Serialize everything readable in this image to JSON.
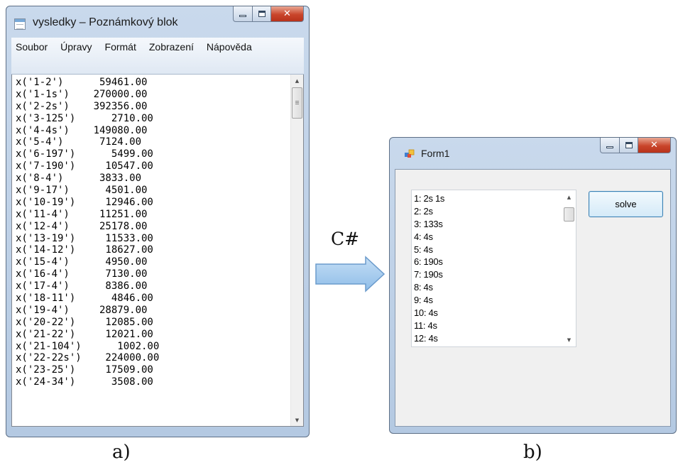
{
  "notepad": {
    "title": "vysledky – Poznámkový blok",
    "menu": [
      "Soubor",
      "Úpravy",
      "Formát",
      "Zobrazení",
      "Nápověda"
    ],
    "lines": [
      "x('1-2')      59461.00",
      "x('1-1s')    270000.00",
      "x('2-2s')    392356.00",
      "x('3-125')      2710.00",
      "x('4-4s')    149080.00",
      "x('5-4')      7124.00",
      "x('6-197')      5499.00",
      "x('7-190')     10547.00",
      "x('8-4')      3833.00",
      "x('9-17')      4501.00",
      "x('10-19')     12946.00",
      "x('11-4')     11251.00",
      "x('12-4')     25178.00",
      "x('13-19')     11533.00",
      "x('14-12')     18627.00",
      "x('15-4')      4950.00",
      "x('16-4')      7130.00",
      "x('17-4')      8386.00",
      "x('18-11')      4846.00",
      "x('19-4')     28879.00",
      "x('20-22')     12085.00",
      "x('21-22')     12021.00",
      "x('21-104')      1002.00",
      "x('22-22s')    224000.00",
      "x('23-25')     17509.00",
      "x('24-34')      3508.00"
    ]
  },
  "arrow_label": "C#",
  "form": {
    "title": "Form1",
    "list_items": [
      "1: 2s 1s",
      "2: 2s",
      "3: 133s",
      "4: 4s",
      "5: 4s",
      "6: 190s",
      "7: 190s",
      "8: 4s",
      "9: 4s",
      "10: 4s",
      "11: 4s",
      "12: 4s"
    ],
    "solve_label": "solve"
  },
  "captions": {
    "a": "a)",
    "b": "b)"
  },
  "colors": {
    "window_frame": "#b9cde5",
    "close_button": "#c9452b",
    "arrow_fill": "#a9cdee",
    "arrow_stroke": "#6b9bcc",
    "button_border": "#3c7fb1"
  }
}
